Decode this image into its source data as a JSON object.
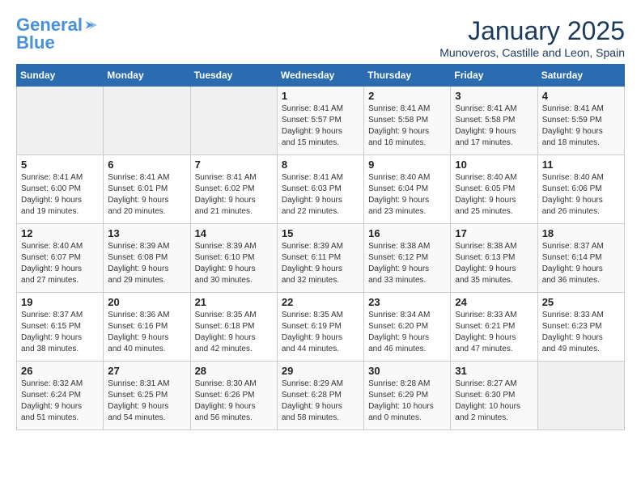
{
  "logo": {
    "line1": "General",
    "line2": "Blue"
  },
  "title": "January 2025",
  "location": "Munoveros, Castille and Leon, Spain",
  "days_header": [
    "Sunday",
    "Monday",
    "Tuesday",
    "Wednesday",
    "Thursday",
    "Friday",
    "Saturday"
  ],
  "weeks": [
    [
      {
        "day": "",
        "info": ""
      },
      {
        "day": "",
        "info": ""
      },
      {
        "day": "",
        "info": ""
      },
      {
        "day": "1",
        "info": "Sunrise: 8:41 AM\nSunset: 5:57 PM\nDaylight: 9 hours\nand 15 minutes."
      },
      {
        "day": "2",
        "info": "Sunrise: 8:41 AM\nSunset: 5:58 PM\nDaylight: 9 hours\nand 16 minutes."
      },
      {
        "day": "3",
        "info": "Sunrise: 8:41 AM\nSunset: 5:58 PM\nDaylight: 9 hours\nand 17 minutes."
      },
      {
        "day": "4",
        "info": "Sunrise: 8:41 AM\nSunset: 5:59 PM\nDaylight: 9 hours\nand 18 minutes."
      }
    ],
    [
      {
        "day": "5",
        "info": "Sunrise: 8:41 AM\nSunset: 6:00 PM\nDaylight: 9 hours\nand 19 minutes."
      },
      {
        "day": "6",
        "info": "Sunrise: 8:41 AM\nSunset: 6:01 PM\nDaylight: 9 hours\nand 20 minutes."
      },
      {
        "day": "7",
        "info": "Sunrise: 8:41 AM\nSunset: 6:02 PM\nDaylight: 9 hours\nand 21 minutes."
      },
      {
        "day": "8",
        "info": "Sunrise: 8:41 AM\nSunset: 6:03 PM\nDaylight: 9 hours\nand 22 minutes."
      },
      {
        "day": "9",
        "info": "Sunrise: 8:40 AM\nSunset: 6:04 PM\nDaylight: 9 hours\nand 23 minutes."
      },
      {
        "day": "10",
        "info": "Sunrise: 8:40 AM\nSunset: 6:05 PM\nDaylight: 9 hours\nand 25 minutes."
      },
      {
        "day": "11",
        "info": "Sunrise: 8:40 AM\nSunset: 6:06 PM\nDaylight: 9 hours\nand 26 minutes."
      }
    ],
    [
      {
        "day": "12",
        "info": "Sunrise: 8:40 AM\nSunset: 6:07 PM\nDaylight: 9 hours\nand 27 minutes."
      },
      {
        "day": "13",
        "info": "Sunrise: 8:39 AM\nSunset: 6:08 PM\nDaylight: 9 hours\nand 29 minutes."
      },
      {
        "day": "14",
        "info": "Sunrise: 8:39 AM\nSunset: 6:10 PM\nDaylight: 9 hours\nand 30 minutes."
      },
      {
        "day": "15",
        "info": "Sunrise: 8:39 AM\nSunset: 6:11 PM\nDaylight: 9 hours\nand 32 minutes."
      },
      {
        "day": "16",
        "info": "Sunrise: 8:38 AM\nSunset: 6:12 PM\nDaylight: 9 hours\nand 33 minutes."
      },
      {
        "day": "17",
        "info": "Sunrise: 8:38 AM\nSunset: 6:13 PM\nDaylight: 9 hours\nand 35 minutes."
      },
      {
        "day": "18",
        "info": "Sunrise: 8:37 AM\nSunset: 6:14 PM\nDaylight: 9 hours\nand 36 minutes."
      }
    ],
    [
      {
        "day": "19",
        "info": "Sunrise: 8:37 AM\nSunset: 6:15 PM\nDaylight: 9 hours\nand 38 minutes."
      },
      {
        "day": "20",
        "info": "Sunrise: 8:36 AM\nSunset: 6:16 PM\nDaylight: 9 hours\nand 40 minutes."
      },
      {
        "day": "21",
        "info": "Sunrise: 8:35 AM\nSunset: 6:18 PM\nDaylight: 9 hours\nand 42 minutes."
      },
      {
        "day": "22",
        "info": "Sunrise: 8:35 AM\nSunset: 6:19 PM\nDaylight: 9 hours\nand 44 minutes."
      },
      {
        "day": "23",
        "info": "Sunrise: 8:34 AM\nSunset: 6:20 PM\nDaylight: 9 hours\nand 46 minutes."
      },
      {
        "day": "24",
        "info": "Sunrise: 8:33 AM\nSunset: 6:21 PM\nDaylight: 9 hours\nand 47 minutes."
      },
      {
        "day": "25",
        "info": "Sunrise: 8:33 AM\nSunset: 6:23 PM\nDaylight: 9 hours\nand 49 minutes."
      }
    ],
    [
      {
        "day": "26",
        "info": "Sunrise: 8:32 AM\nSunset: 6:24 PM\nDaylight: 9 hours\nand 51 minutes."
      },
      {
        "day": "27",
        "info": "Sunrise: 8:31 AM\nSunset: 6:25 PM\nDaylight: 9 hours\nand 54 minutes."
      },
      {
        "day": "28",
        "info": "Sunrise: 8:30 AM\nSunset: 6:26 PM\nDaylight: 9 hours\nand 56 minutes."
      },
      {
        "day": "29",
        "info": "Sunrise: 8:29 AM\nSunset: 6:28 PM\nDaylight: 9 hours\nand 58 minutes."
      },
      {
        "day": "30",
        "info": "Sunrise: 8:28 AM\nSunset: 6:29 PM\nDaylight: 10 hours\nand 0 minutes."
      },
      {
        "day": "31",
        "info": "Sunrise: 8:27 AM\nSunset: 6:30 PM\nDaylight: 10 hours\nand 2 minutes."
      },
      {
        "day": "",
        "info": ""
      }
    ]
  ]
}
